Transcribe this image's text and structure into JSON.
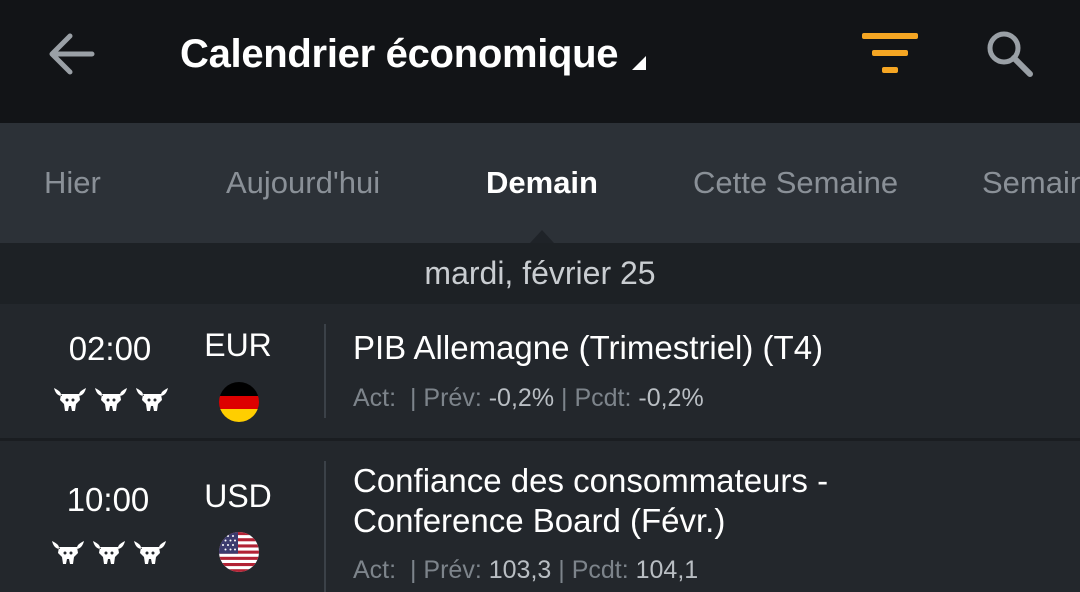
{
  "header": {
    "title": "Calendrier économique",
    "icons": [
      "back-arrow-icon",
      "dropdown-caret-icon",
      "filter-icon",
      "search-icon"
    ],
    "filter_color": "#f5a623"
  },
  "tabs": [
    {
      "label": "Hier",
      "active": false
    },
    {
      "label": "Aujourd'hui",
      "active": false
    },
    {
      "label": "Demain",
      "active": true
    },
    {
      "label": "Cette Semaine",
      "active": false
    },
    {
      "label": "Semaine prochaine",
      "active": false
    }
  ],
  "date_header": "mardi, février 25",
  "events": [
    {
      "time": "02:00",
      "importance": 3,
      "currency": "EUR",
      "flag": "germany-flag-icon",
      "title": "PIB Allemagne (Trimestriel) (T4)",
      "actual_label": "Act:",
      "actual_value": "",
      "forecast_label": "| Prév:",
      "forecast_value": "-0,2%",
      "previous_label": "| Pcdt:",
      "previous_value": "-0,2%"
    },
    {
      "time": "10:00",
      "importance": 3,
      "currency": "USD",
      "flag": "usa-flag-icon",
      "title_line1": "Confiance des consommateurs -",
      "title_line2": "Conference Board (Févr.)",
      "actual_label": "Act:",
      "actual_value": "",
      "forecast_label": "| Prév:",
      "forecast_value": "103,3",
      "previous_label": "| Pcdt:",
      "previous_value": "104,1"
    }
  ]
}
